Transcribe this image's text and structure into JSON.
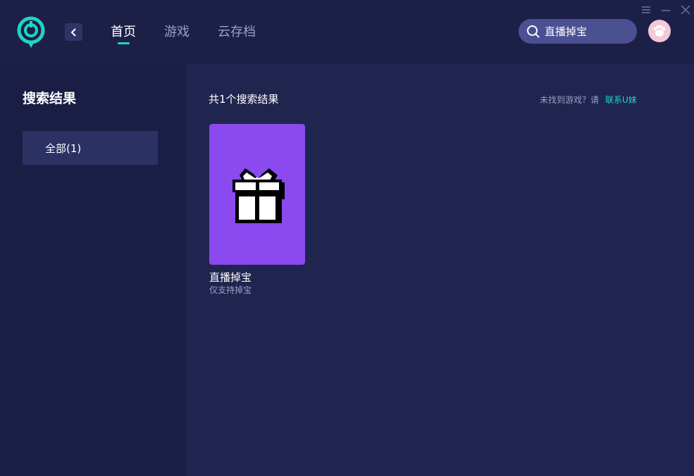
{
  "app": {
    "logo_icon": "app-logo-icon",
    "accent_color": "#1fd6c0"
  },
  "nav": {
    "tabs": [
      {
        "label": "首页",
        "active": true
      },
      {
        "label": "游戏",
        "active": false
      },
      {
        "label": "云存档",
        "active": false
      }
    ]
  },
  "search": {
    "value": "直播掉宝",
    "icon": "search-icon"
  },
  "window_controls": [
    "menu-icon",
    "minimize-icon",
    "close-icon"
  ],
  "sidebar": {
    "title": "搜索结果",
    "items": [
      {
        "label": "全部(1)",
        "selected": true
      }
    ]
  },
  "main": {
    "result_count": "共1个搜索结果",
    "not_found_text": "未找到游戏？请",
    "contact_link": "联系U妹",
    "cards": [
      {
        "title": "直播掉宝",
        "subtitle": "仅支持掉宝",
        "icon": "gift-icon",
        "cover_color": "#8b4aef"
      }
    ]
  }
}
